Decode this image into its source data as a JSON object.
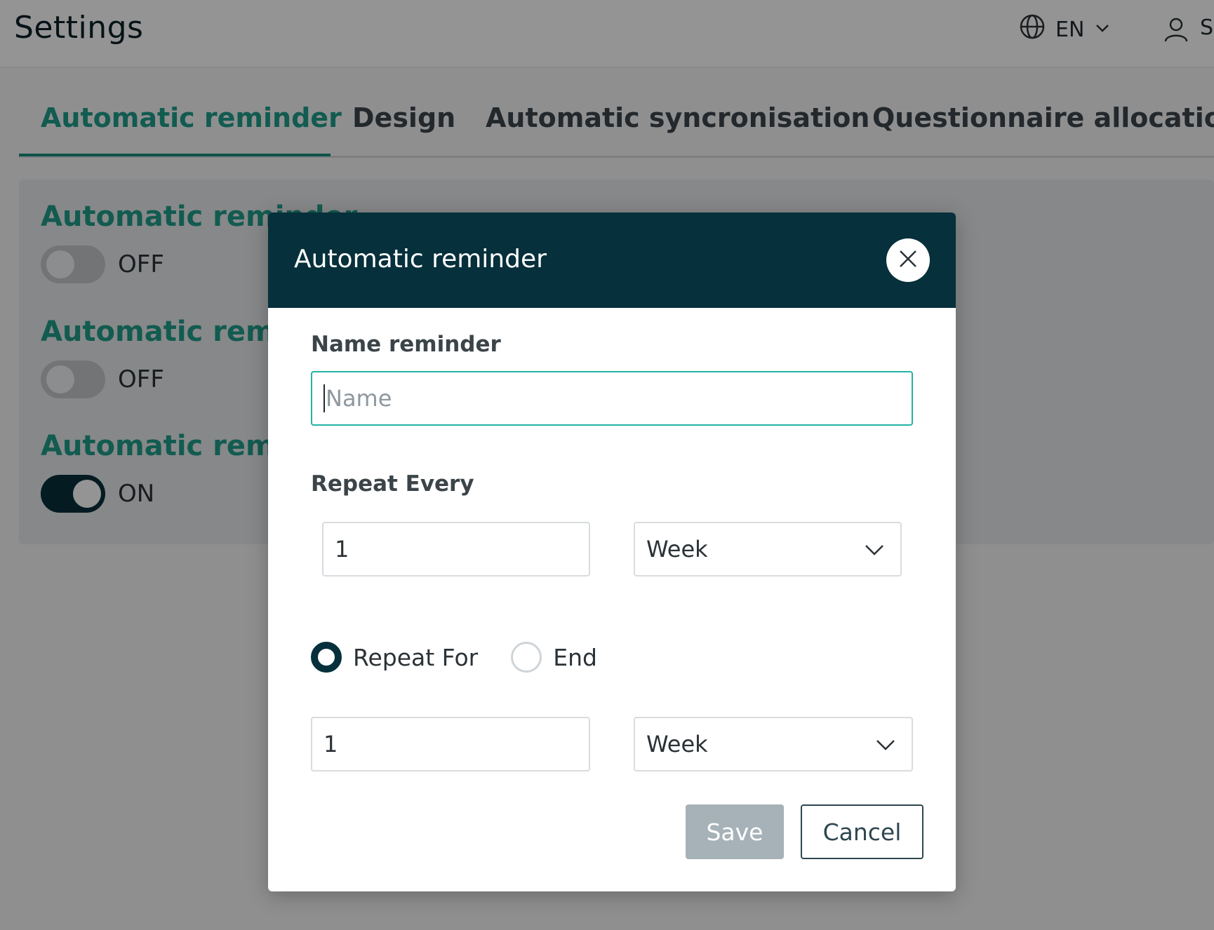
{
  "header": {
    "title": "Settings",
    "language": "EN",
    "user_initial": "S"
  },
  "tabs": [
    {
      "label": "Automatic reminder",
      "active": true
    },
    {
      "label": "Design",
      "active": false
    },
    {
      "label": "Automatic syncronisation",
      "active": false
    },
    {
      "label": "Questionnaire allocation",
      "active": false
    }
  ],
  "settings": [
    {
      "title": "Automatic reminder",
      "state": "OFF"
    },
    {
      "title": "Automatic reminder",
      "state": "OFF"
    },
    {
      "title": "Automatic reminder",
      "state": "ON"
    }
  ],
  "modal": {
    "title": "Automatic reminder",
    "name_label": "Name reminder",
    "name_placeholder": "Name",
    "name_value": "",
    "repeat_every_label": "Repeat Every",
    "repeat_every_value": "1",
    "repeat_every_unit": "Week",
    "radio_options": [
      {
        "label": "Repeat For",
        "checked": true
      },
      {
        "label": "End",
        "checked": false
      }
    ],
    "repeat_for_value": "1",
    "repeat_for_unit": "Week",
    "save_label": "Save",
    "cancel_label": "Cancel"
  },
  "colors": {
    "accent": "#1f9d8a",
    "header_dark": "#06303b",
    "focus_border": "#22b3a3",
    "save_disabled": "#a6b2b7"
  }
}
